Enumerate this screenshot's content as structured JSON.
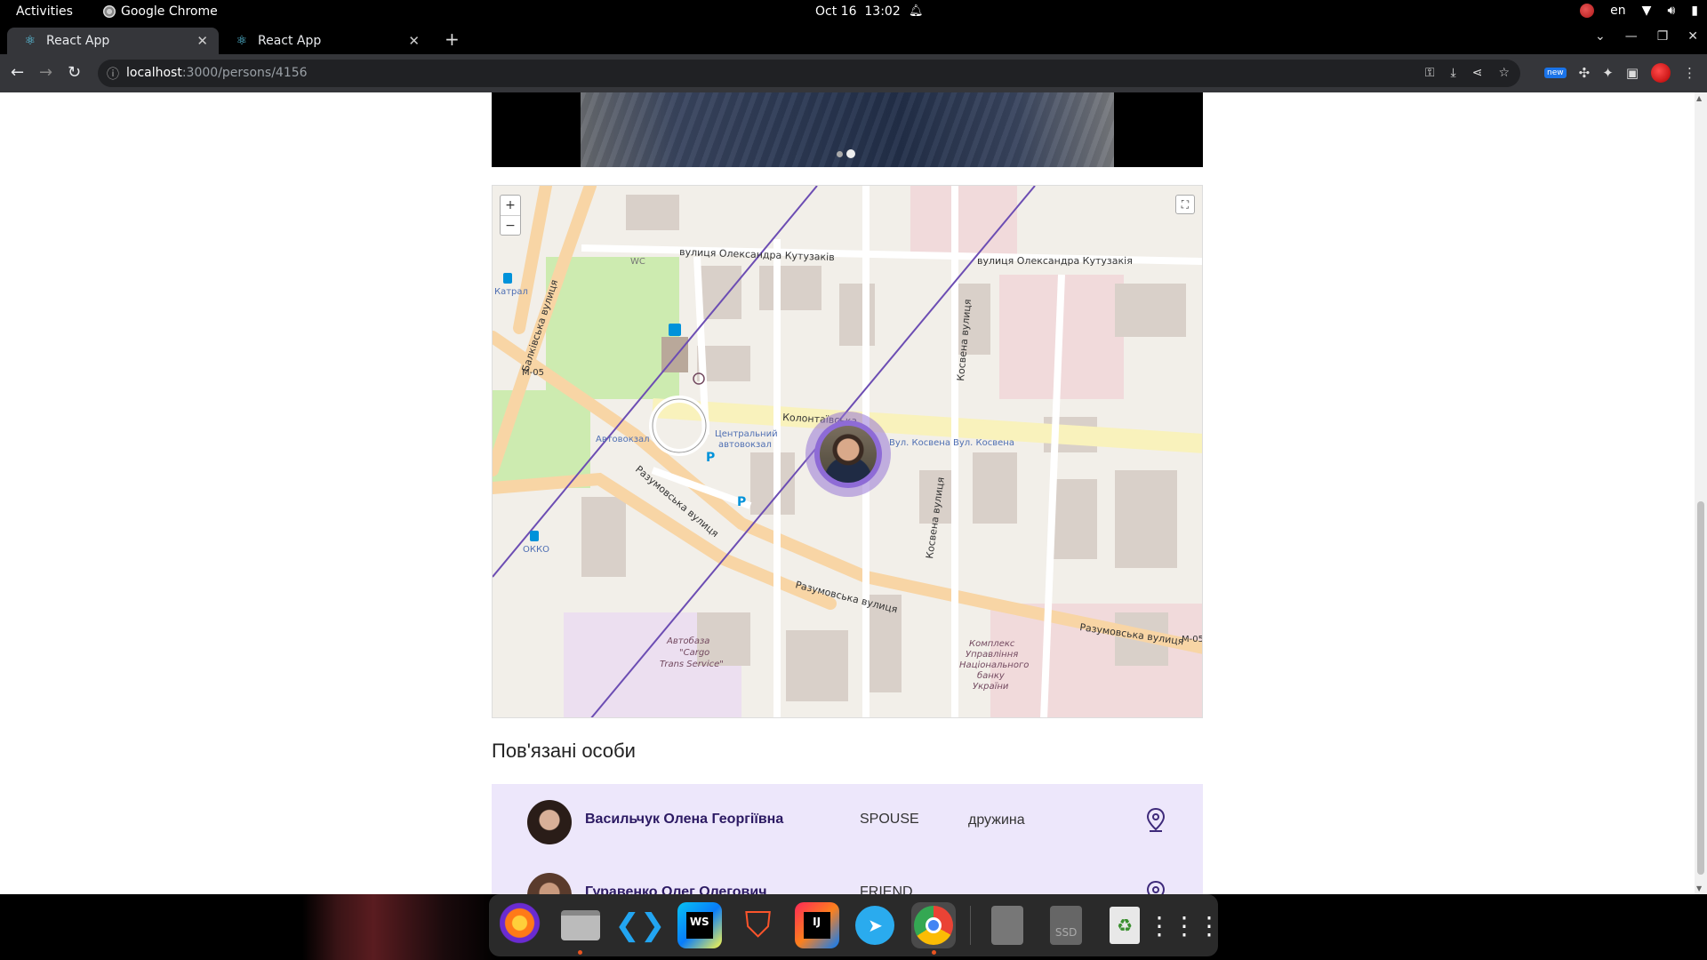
{
  "system_bar": {
    "activities": "Activities",
    "app_name": "Google Chrome",
    "date": "Oct 16",
    "time": "13:02",
    "language": "en"
  },
  "tabs": [
    {
      "title": "React App",
      "active": true
    },
    {
      "title": "React App",
      "active": false
    }
  ],
  "address_bar": {
    "host": "localhost",
    "path": ":3000/persons/4156"
  },
  "extensions": {
    "new_badge": "new"
  },
  "map": {
    "labels": {
      "street_kutuzova_1": "вулиця Олександра Кутузаків",
      "street_kutuzova_2": "вулиця Олександра Кутузакія",
      "street_balkivska": "Балківська вулиця",
      "street_kolontaivska": "Колонтаївська",
      "street_kosvena_1": "Косвена вулиця",
      "street_kosvena_2": "Косвена вулиця",
      "street_razumovska_1": "Разумовська вулиця",
      "street_razumovska_2": "Разумовська вулиця",
      "street_razumovska_3": "Разумовська вулиця",
      "route_m05_1": "M-05",
      "route_m05_2": "M-05",
      "poi_avtovokzal": "Автовокзал",
      "poi_central_1": "Центральний",
      "poi_central_2": "автовокзал",
      "poi_katral": "Катрал",
      "poi_okko": "ОККО",
      "poi_wc": "WC",
      "stop_kosvena_1": "Вул. Косвена",
      "stop_kosvena_2": "Вул. Косвена",
      "poi_cargo_1": "Автобаза",
      "poi_cargo_2": "\"Cargo",
      "poi_cargo_3": "Trans Service\"",
      "poi_nbu_1": "Комплекс",
      "poi_nbu_2": "Управління",
      "poi_nbu_3": "Національного",
      "poi_nbu_4": "банку",
      "poi_nbu_5": "України"
    },
    "zoom_in": "+",
    "zoom_out": "−",
    "fullscreen": "⛶"
  },
  "related": {
    "title": "Пов'язані особи",
    "rows": [
      {
        "name": "Васильчук Олена Георгіївна",
        "type": "SPOUSE",
        "description": "дружина",
        "avatar_color": "#3b2a26"
      },
      {
        "name": "Гуравенко Олег Олегович",
        "type": "FRIEND",
        "description": "",
        "avatar_color": "#6b4a3a"
      }
    ]
  },
  "dock": {
    "items": [
      "firefox-icon",
      "files-icon",
      "vscode-icon",
      "webstorm-icon",
      "brave-icon",
      "intellij-icon",
      "telegram-icon",
      "chrome-icon",
      "drive-icon",
      "ssd-icon",
      "trash-icon",
      "apps-grid-icon"
    ],
    "ssd_label": "SSD"
  }
}
